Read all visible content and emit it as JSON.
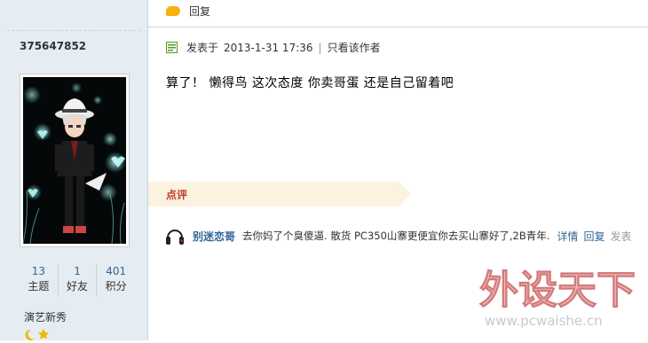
{
  "sidebar": {
    "username": "375647852",
    "stats": [
      {
        "value": "13",
        "label": "主题"
      },
      {
        "value": "1",
        "label": "好友"
      },
      {
        "value": "401",
        "label": "积分"
      }
    ],
    "rank_title": "演艺新秀"
  },
  "top": {
    "reply_label": "回复"
  },
  "post": {
    "posted_prefix": "发表于",
    "timestamp": "2013-1-31 17:36",
    "only_author_label": "只看该作者",
    "content": "算了！ 懒得鸟  这次态度  你卖哥蛋  还是自己留着吧"
  },
  "dianping": {
    "section_label": "点评",
    "comment": {
      "author": "别迷恋哥",
      "text": "去你妈了个臭傻逼. 散货 PC350山寨更便宜你去买山寨好了,2B青年.",
      "detail_link": "详情",
      "reply_link": "回复",
      "trailing": "发表"
    }
  },
  "watermark": {
    "title": "外设天下",
    "url": "www.pcwaishe.cn"
  }
}
